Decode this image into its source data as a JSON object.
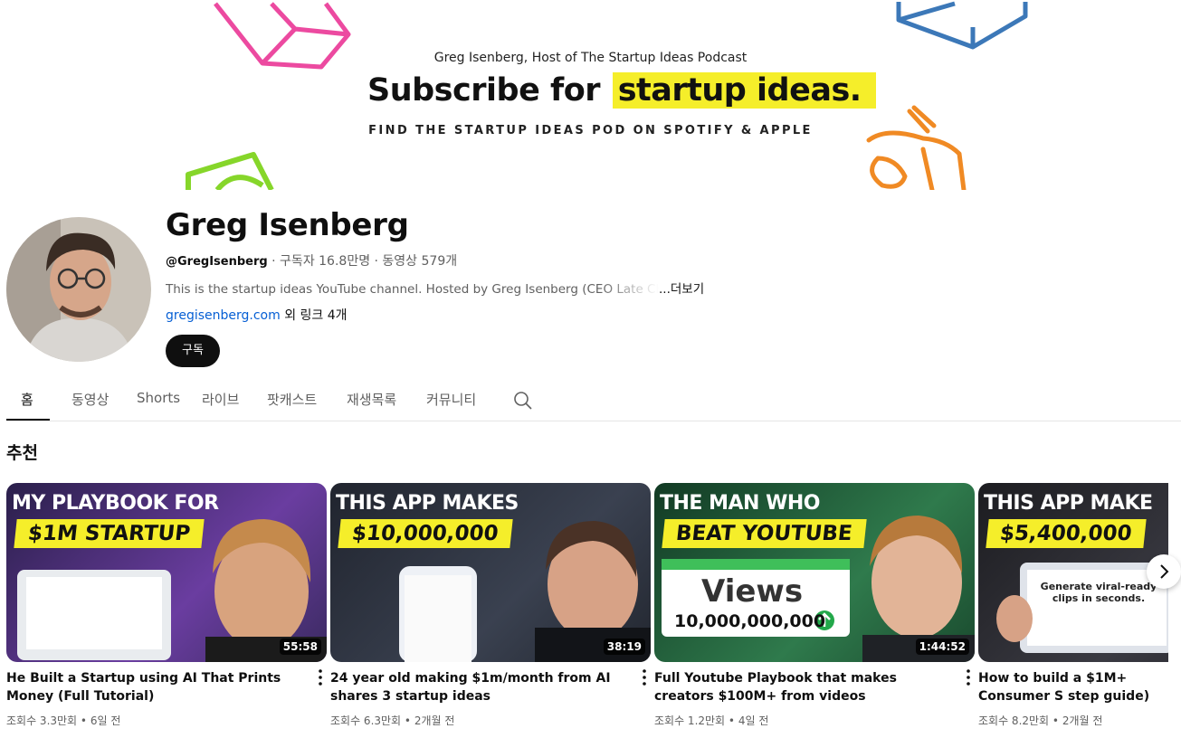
{
  "banner": {
    "host": "Greg Isenberg, Host of The Startup Ideas Podcast",
    "headline_a": "Subscribe for",
    "headline_b": "startup ideas.",
    "subline": "FIND THE STARTUP IDEAS POD ON SPOTIFY & APPLE"
  },
  "channel": {
    "name": "Greg Isenberg",
    "handle": "@GregIsenberg",
    "stats": " · 구독자 16.8만명 · 동영상 579개",
    "description": "This is the startup ideas YouTube channel. Hosted by Greg Isenberg (CEO Late Checkout",
    "more": "...더보기",
    "link": "gregisenberg.com",
    "links_more": " 외 링크 4개",
    "subscribe": "구독"
  },
  "tabs": [
    "홈",
    "동영상",
    "Shorts",
    "라이브",
    "팟캐스트",
    "재생목록",
    "커뮤니티"
  ],
  "section_title": "추천",
  "videos": [
    {
      "line1": "MY PLAYBOOK FOR",
      "line2": "$1M STARTUP",
      "duration": "55:58",
      "title": "He Built a Startup using AI That Prints Money (Full Tutorial)",
      "views": "조회수 3.3만회",
      "age": "6일 전",
      "bg": "#3b2a5e"
    },
    {
      "line1": "THIS APP MAKES",
      "line2": "$10,000,000",
      "duration": "38:19",
      "title": "24 year old making $1m/month from AI shares 3 startup ideas",
      "views": "조회수 6.3만회",
      "age": "2개월 전",
      "bg": "#2e3340"
    },
    {
      "line1": "THE MAN WHO",
      "line2": "BEAT YOUTUBE",
      "duration": "1:44:52",
      "title": "Full Youtube Playbook that makes creators $100M+ from videos",
      "views": "조회수 1.2만회",
      "age": "4일 전",
      "bg": "#1f5a3a"
    },
    {
      "line1": "THIS APP MAKE",
      "line2": "$5,400,000",
      "duration": "",
      "title": "How to build a $1M+ Consumer S step guide)",
      "views": "조회수 8.2만회",
      "age": "2개월 전",
      "bg": "#2c2c30"
    }
  ],
  "thumb_extras": {
    "views_word": "Views",
    "views_count": "10,000,000,000",
    "clip_text": "Generate viral-ready clips in seconds."
  }
}
